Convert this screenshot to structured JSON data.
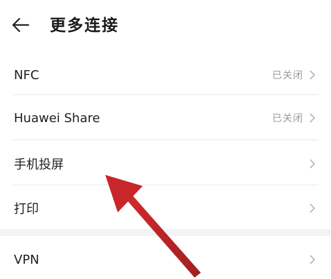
{
  "header": {
    "title": "更多连接",
    "back_icon": "back-arrow-icon"
  },
  "items": [
    {
      "label": "NFC",
      "value": "已关闭"
    },
    {
      "label": "Huawei Share",
      "value": "已关闭"
    },
    {
      "label": "手机投屏",
      "value": ""
    },
    {
      "label": "打印",
      "value": ""
    },
    {
      "label": "VPN",
      "value": ""
    }
  ],
  "colors": {
    "background": "#ffffff",
    "text": "#1f1f1f",
    "secondary_text": "#9a9a9a",
    "annotation_arrow": "#c0262a"
  }
}
